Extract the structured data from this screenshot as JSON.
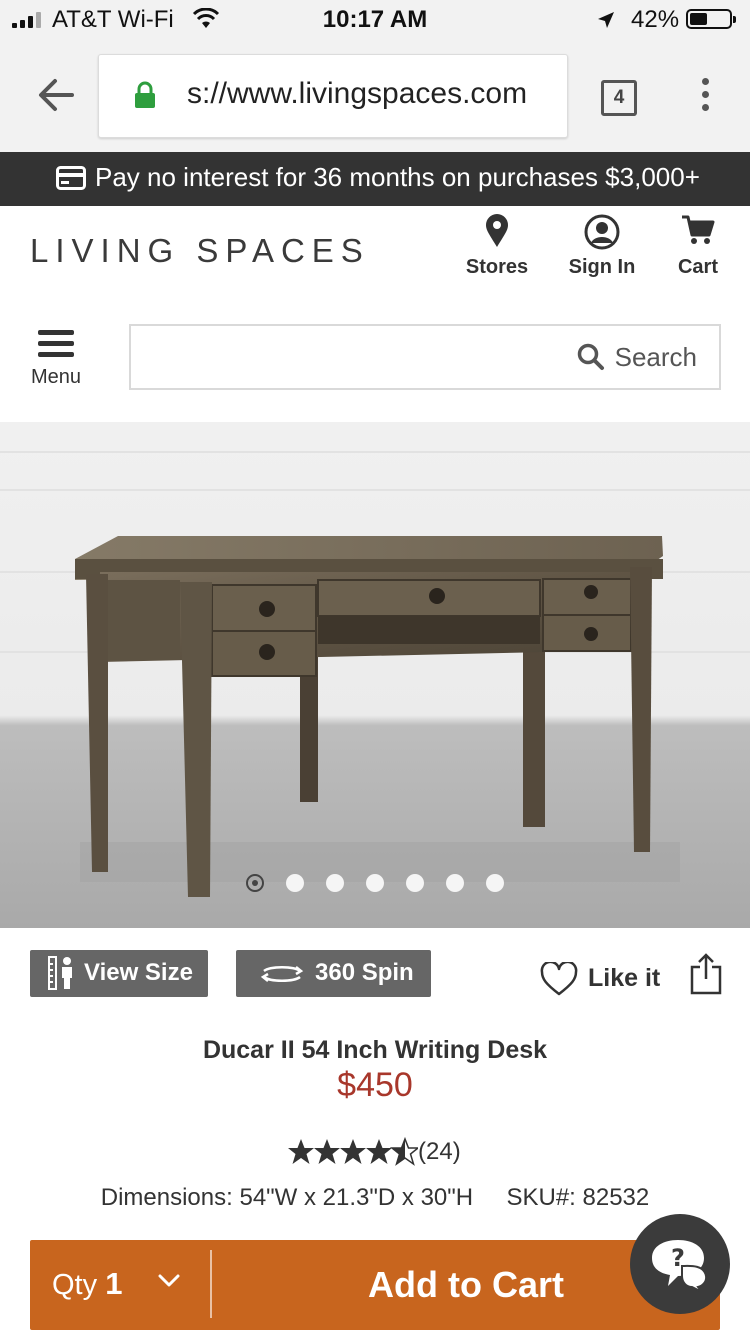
{
  "status_bar": {
    "carrier": "AT&T Wi-Fi",
    "time": "10:17 AM",
    "battery": "42%"
  },
  "browser": {
    "url": "s://www.livingspaces.com",
    "tab_count": "4"
  },
  "promo": {
    "text": "Pay no interest for 36 months on purchases $3,000+"
  },
  "header": {
    "logo": "LIVING SPACES",
    "stores_label": "Stores",
    "signin_label": "Sign In",
    "cart_label": "Cart",
    "menu_label": "Menu",
    "search_label": "Search"
  },
  "gallery": {
    "image_count": 7,
    "active_index": 0
  },
  "actions": {
    "view_size": "View Size",
    "spin": "360 Spin",
    "like": "Like it"
  },
  "product": {
    "name": "Ducar II 54 Inch Writing Desk",
    "price": "$450",
    "rating": 4.5,
    "review_count": "(24)",
    "dimensions": "Dimensions: 54\"W x 21.3\"D x 30\"H",
    "sku": "SKU#: 82532"
  },
  "cart": {
    "qty_label": "Qty",
    "qty_value": "1",
    "add_label": "Add to Cart"
  },
  "colors": {
    "promo_bg": "#333333",
    "price": "#a8372b",
    "cart_button": "#c8651e",
    "action_button": "#666666",
    "lock": "#2e9e3e"
  }
}
